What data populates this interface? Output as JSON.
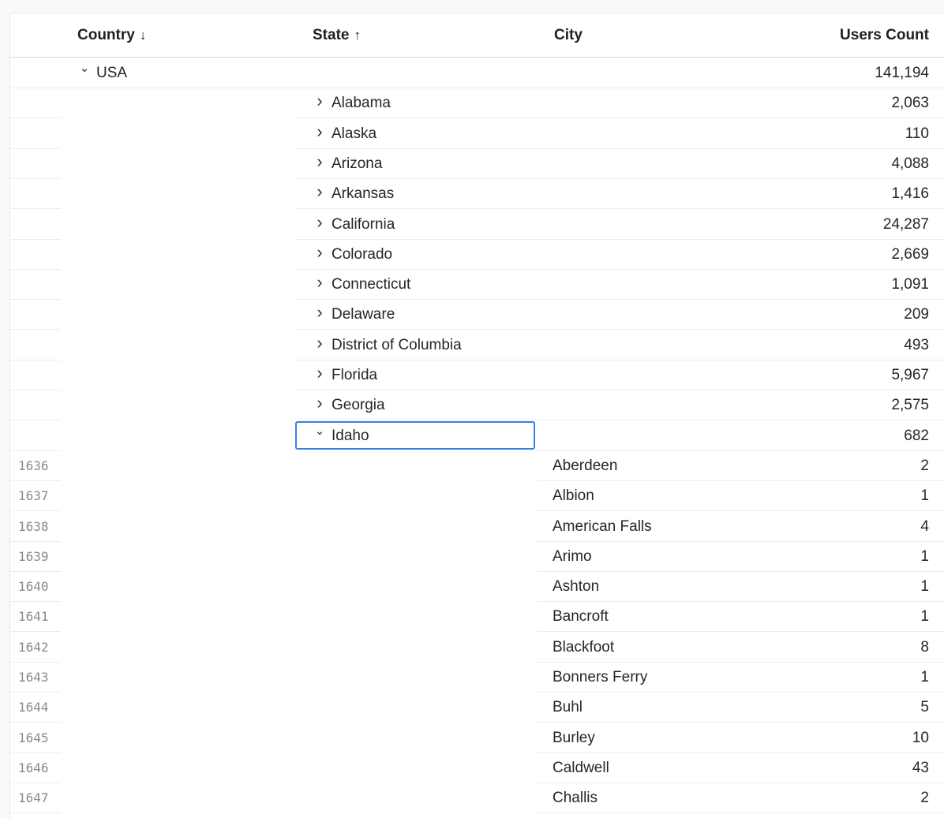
{
  "columns": {
    "country": {
      "label": "Country",
      "sort_icon": "↓"
    },
    "state": {
      "label": "State",
      "sort_icon": "↑"
    },
    "city": {
      "label": "City"
    },
    "users_count": {
      "label": "Users Count"
    }
  },
  "country_row": {
    "name": "USA",
    "count": "141,194",
    "chevron": "⌄"
  },
  "state_rows": [
    {
      "name": "Alabama",
      "count": "2,063"
    },
    {
      "name": "Alaska",
      "count": "110"
    },
    {
      "name": "Arizona",
      "count": "4,088"
    },
    {
      "name": "Arkansas",
      "count": "1,416"
    },
    {
      "name": "California",
      "count": "24,287"
    },
    {
      "name": "Colorado",
      "count": "2,669"
    },
    {
      "name": "Connecticut",
      "count": "1,091"
    },
    {
      "name": "Delaware",
      "count": "209"
    },
    {
      "name": "District of Columbia",
      "count": "493"
    },
    {
      "name": "Florida",
      "count": "5,967"
    },
    {
      "name": "Georgia",
      "count": "2,575"
    }
  ],
  "expanded_state": {
    "name": "Idaho",
    "count": "682"
  },
  "city_rows": [
    {
      "row": "1636",
      "name": "Aberdeen",
      "count": "2"
    },
    {
      "row": "1637",
      "name": "Albion",
      "count": "1"
    },
    {
      "row": "1638",
      "name": "American Falls",
      "count": "4"
    },
    {
      "row": "1639",
      "name": "Arimo",
      "count": "1"
    },
    {
      "row": "1640",
      "name": "Ashton",
      "count": "1"
    },
    {
      "row": "1641",
      "name": "Bancroft",
      "count": "1"
    },
    {
      "row": "1642",
      "name": "Blackfoot",
      "count": "8"
    },
    {
      "row": "1643",
      "name": "Bonners Ferry",
      "count": "1"
    },
    {
      "row": "1644",
      "name": "Buhl",
      "count": "5"
    },
    {
      "row": "1645",
      "name": "Burley",
      "count": "10"
    },
    {
      "row": "1646",
      "name": "Caldwell",
      "count": "43"
    },
    {
      "row": "1647",
      "name": "Challis",
      "count": "2"
    }
  ],
  "colors": {
    "selection": "#3b7de8",
    "grid": "#ececec",
    "row_number": "#8a8a8a"
  }
}
